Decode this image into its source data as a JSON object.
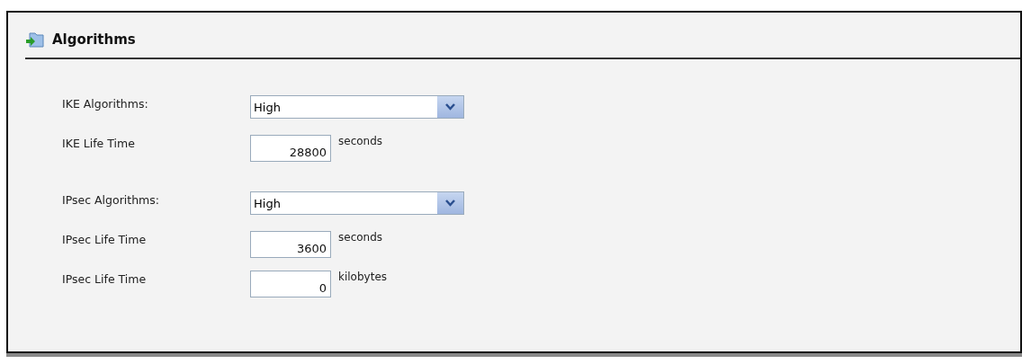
{
  "panel": {
    "title": "Algorithms"
  },
  "groups": [
    {
      "rows": [
        {
          "kind": "select",
          "label": "IKE Algorithms:",
          "value": "High"
        },
        {
          "kind": "number",
          "label": "IKE Life Time",
          "value": "28800",
          "unit": "seconds"
        }
      ]
    },
    {
      "rows": [
        {
          "kind": "select",
          "label": "IPsec Algorithms:",
          "value": "High"
        },
        {
          "kind": "number",
          "label": "IPsec Life Time",
          "value": "3600",
          "unit": "seconds"
        },
        {
          "kind": "number",
          "label": "IPsec Life Time",
          "value": "0",
          "unit": "kilobytes"
        }
      ]
    }
  ]
}
